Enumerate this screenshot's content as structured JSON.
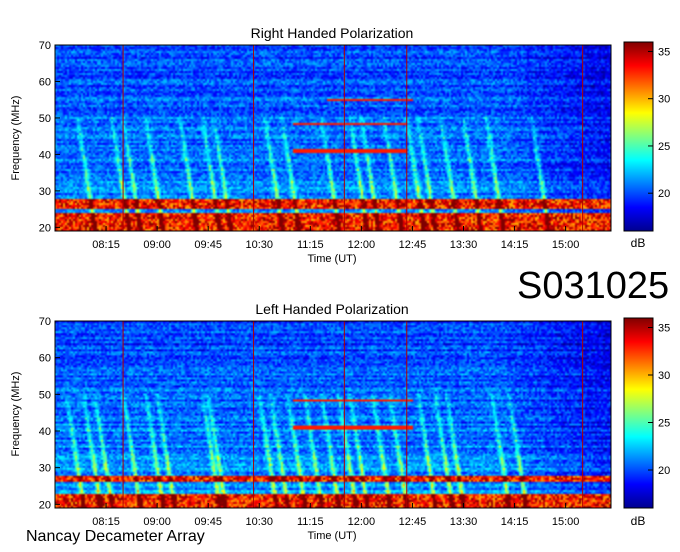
{
  "observation_code": "S031025",
  "footer": "Nancay Decameter Array",
  "colorbar": {
    "unit": "dB",
    "ticks": [
      20,
      25,
      30,
      35
    ],
    "range": [
      16,
      36
    ],
    "colormap": [
      "#00008f",
      "#0000ff",
      "#0080ff",
      "#00ffff",
      "#80ff80",
      "#ffff00",
      "#ff8000",
      "#ff0000",
      "#800000"
    ]
  },
  "chart_data": [
    {
      "type": "heatmap",
      "title": "Right Handed Polarization",
      "xlabel": "Time (UT)",
      "ylabel": "Frequency (MHz)",
      "x_tick_labels": [
        "08:15",
        "09:00",
        "09:45",
        "10:30",
        "11:15",
        "12:00",
        "12:45",
        "13:30",
        "14:15",
        "15:00"
      ],
      "xlim": [
        "07:30",
        "15:40"
      ],
      "ylim": [
        19,
        70
      ],
      "y_ticks": [
        20,
        30,
        40,
        50,
        60,
        70
      ],
      "value_unit": "dB",
      "value_range": [
        16,
        36
      ],
      "features": {
        "strong_band_mhz": [
          [
            25,
            28
          ],
          [
            19,
            24
          ]
        ],
        "cw_lines": [
          {
            "freq": 41,
            "from": "11:00",
            "to": "12:40"
          },
          {
            "freq": 48.5,
            "from": "11:00",
            "to": "12:40"
          },
          {
            "freq": 55,
            "from": "11:30",
            "to": "12:45"
          }
        ],
        "burst_times": [
          "08:05",
          "08:35",
          "08:45",
          "09:05",
          "09:35",
          "09:55",
          "10:05",
          "10:50",
          "11:05",
          "11:40",
          "12:05",
          "12:15",
          "12:35",
          "12:55",
          "13:05",
          "13:25",
          "13:45",
          "14:05",
          "14:45"
        ],
        "interference_times": [
          "08:30",
          "10:25",
          "11:45",
          "12:40",
          "15:15"
        ]
      }
    },
    {
      "type": "heatmap",
      "title": "Left Handed Polarization",
      "xlabel": "Time (UT)",
      "ylabel": "Frequency (MHz)",
      "x_tick_labels": [
        "08:15",
        "09:00",
        "09:45",
        "10:30",
        "11:15",
        "12:00",
        "12:45",
        "13:30",
        "14:15",
        "15:00"
      ],
      "xlim": [
        "07:30",
        "15:40"
      ],
      "ylim": [
        19,
        70
      ],
      "y_ticks": [
        20,
        30,
        40,
        50,
        60,
        70
      ],
      "value_unit": "dB",
      "value_range": [
        16,
        36
      ],
      "features": {
        "strong_band_mhz": [
          [
            26,
            28
          ],
          [
            19,
            23
          ]
        ],
        "cw_lines": [
          {
            "freq": 41,
            "from": "11:00",
            "to": "12:45"
          },
          {
            "freq": 48.5,
            "from": "11:00",
            "to": "12:45"
          }
        ],
        "burst_times": [
          "07:55",
          "08:10",
          "08:20",
          "08:45",
          "09:05",
          "09:15",
          "09:55",
          "10:00",
          "10:45",
          "10:55",
          "11:10",
          "11:25",
          "11:40",
          "11:55",
          "12:05",
          "12:25",
          "12:40",
          "13:05",
          "13:20",
          "13:30",
          "14:10",
          "14:25"
        ],
        "interference_times": [
          "08:30",
          "10:25",
          "11:45",
          "12:40",
          "15:15"
        ]
      }
    }
  ]
}
